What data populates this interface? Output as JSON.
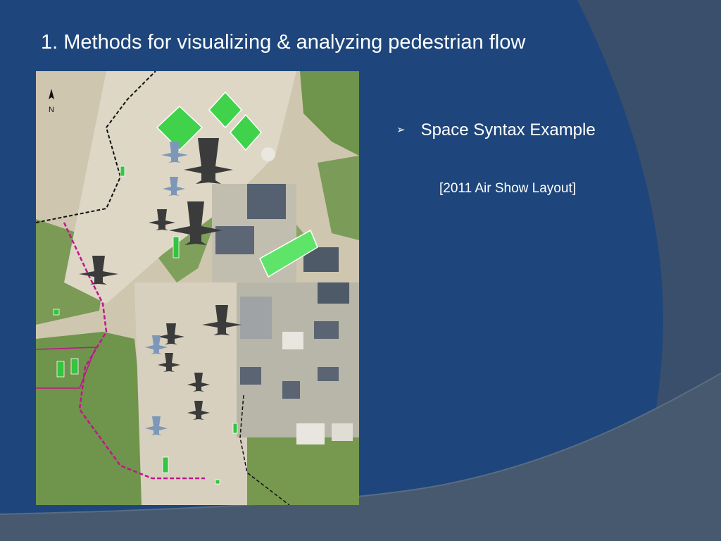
{
  "slide": {
    "title": "1. Methods for visualizing & analyzing pedestrian flow",
    "bullet": {
      "marker": "➢",
      "text": "Space Syntax Example"
    },
    "caption": "[2011 Air Show Layout]"
  },
  "map": {
    "description_icon": "aerial-map-image",
    "north_label": "N"
  },
  "colors": {
    "background": "#1e467c",
    "swoosh_dark": "#3a4f6c",
    "swoosh_light": "#47596f",
    "text": "#ffffff",
    "highlight_green": "#3fd24a",
    "boundary_magenta": "#c0168c"
  }
}
